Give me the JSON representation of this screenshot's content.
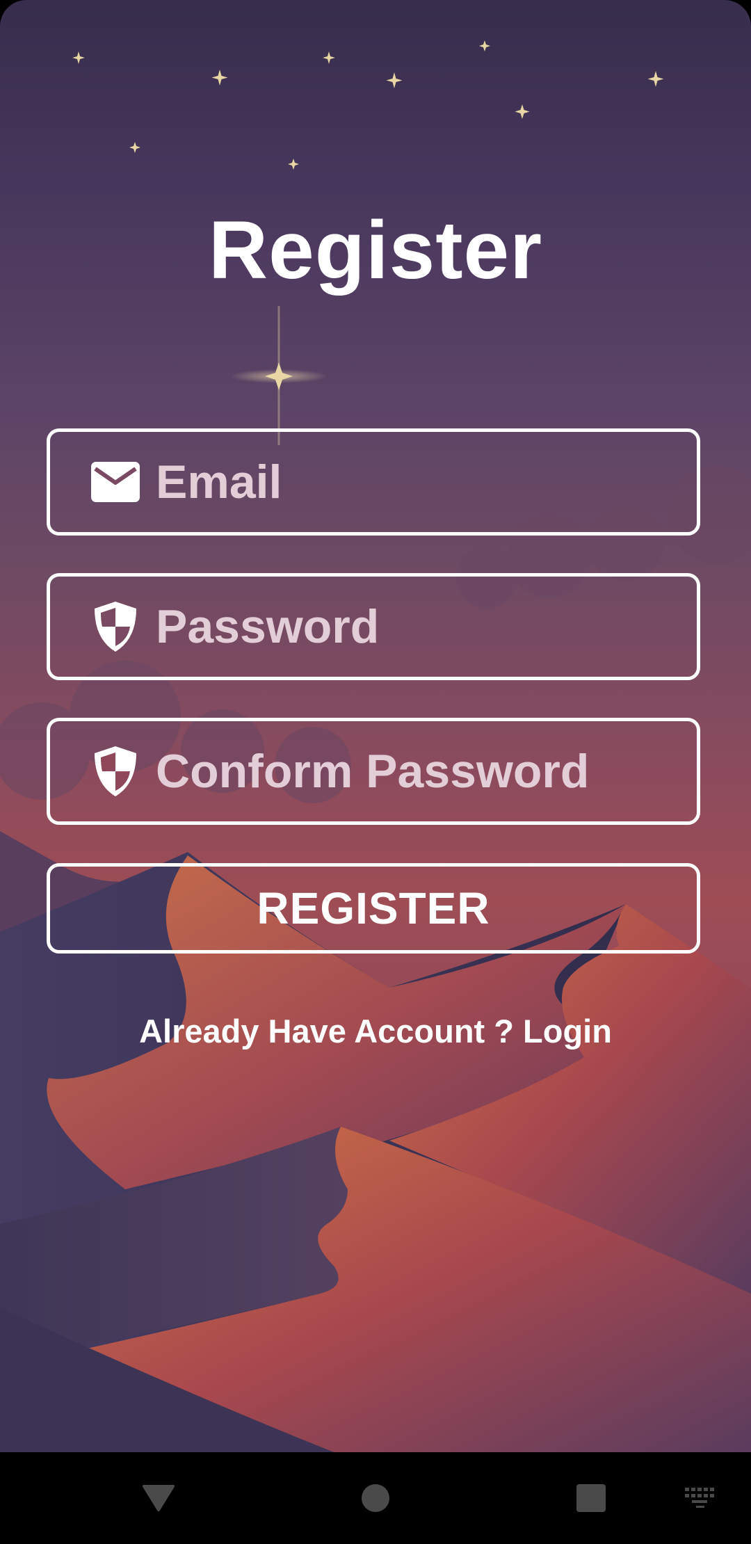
{
  "colors": {
    "background_top": "#372d4c",
    "background_mid": "#9e4d55",
    "dune_dark": "#3c3355",
    "dune_orange": "#c06a45",
    "text_primary": "#ffffff",
    "placeholder": "#e3cdd7",
    "star": "#e8d6a4"
  },
  "screen": {
    "title": "Register"
  },
  "form": {
    "email": {
      "placeholder": "Email",
      "icon": "envelope-icon"
    },
    "password": {
      "placeholder": "Password",
      "icon": "shield-icon"
    },
    "confirm_password": {
      "placeholder": "Conform Password",
      "icon": "shield-icon"
    },
    "submit_label": "REGISTER"
  },
  "footer": {
    "login_prompt": "Already Have Account ? Login"
  },
  "navbar": {
    "back": "triangle-back-icon",
    "home": "circle-home-icon",
    "recents": "square-recents-icon",
    "keyboard": "keyboard-icon"
  }
}
